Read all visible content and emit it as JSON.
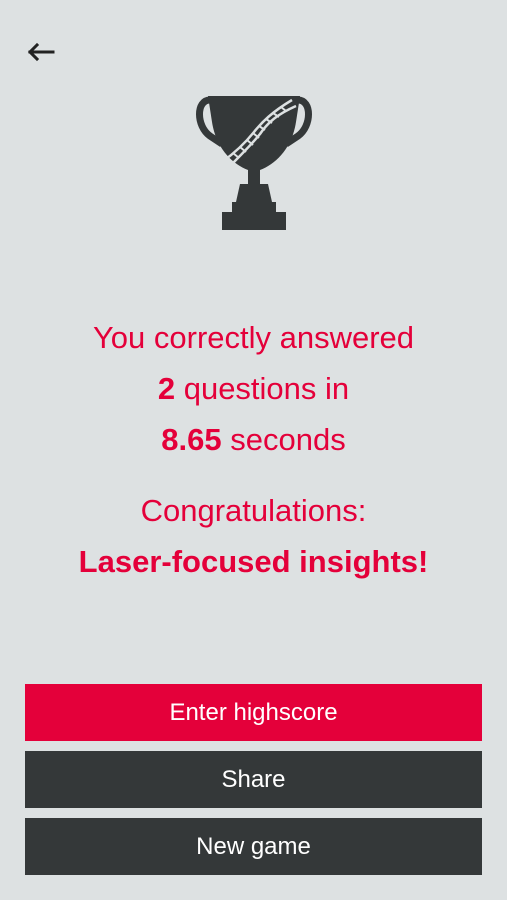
{
  "nav": {
    "back_icon": "arrow-left-icon"
  },
  "trophy": {
    "icon": "dna-trophy-icon"
  },
  "result": {
    "line1": "You correctly answered",
    "count": "2",
    "line2_suffix": " questions in",
    "time": "8.65",
    "line3_suffix": " seconds",
    "congrats": "Congratulations:",
    "motto": "Laser-focused insights!"
  },
  "buttons": {
    "highscore_label": "Enter highscore",
    "share_label": "Share",
    "new_game_label": "New game"
  },
  "colors": {
    "accent": "#e4003a",
    "dark": "#343839",
    "background": "#dde1e2"
  }
}
